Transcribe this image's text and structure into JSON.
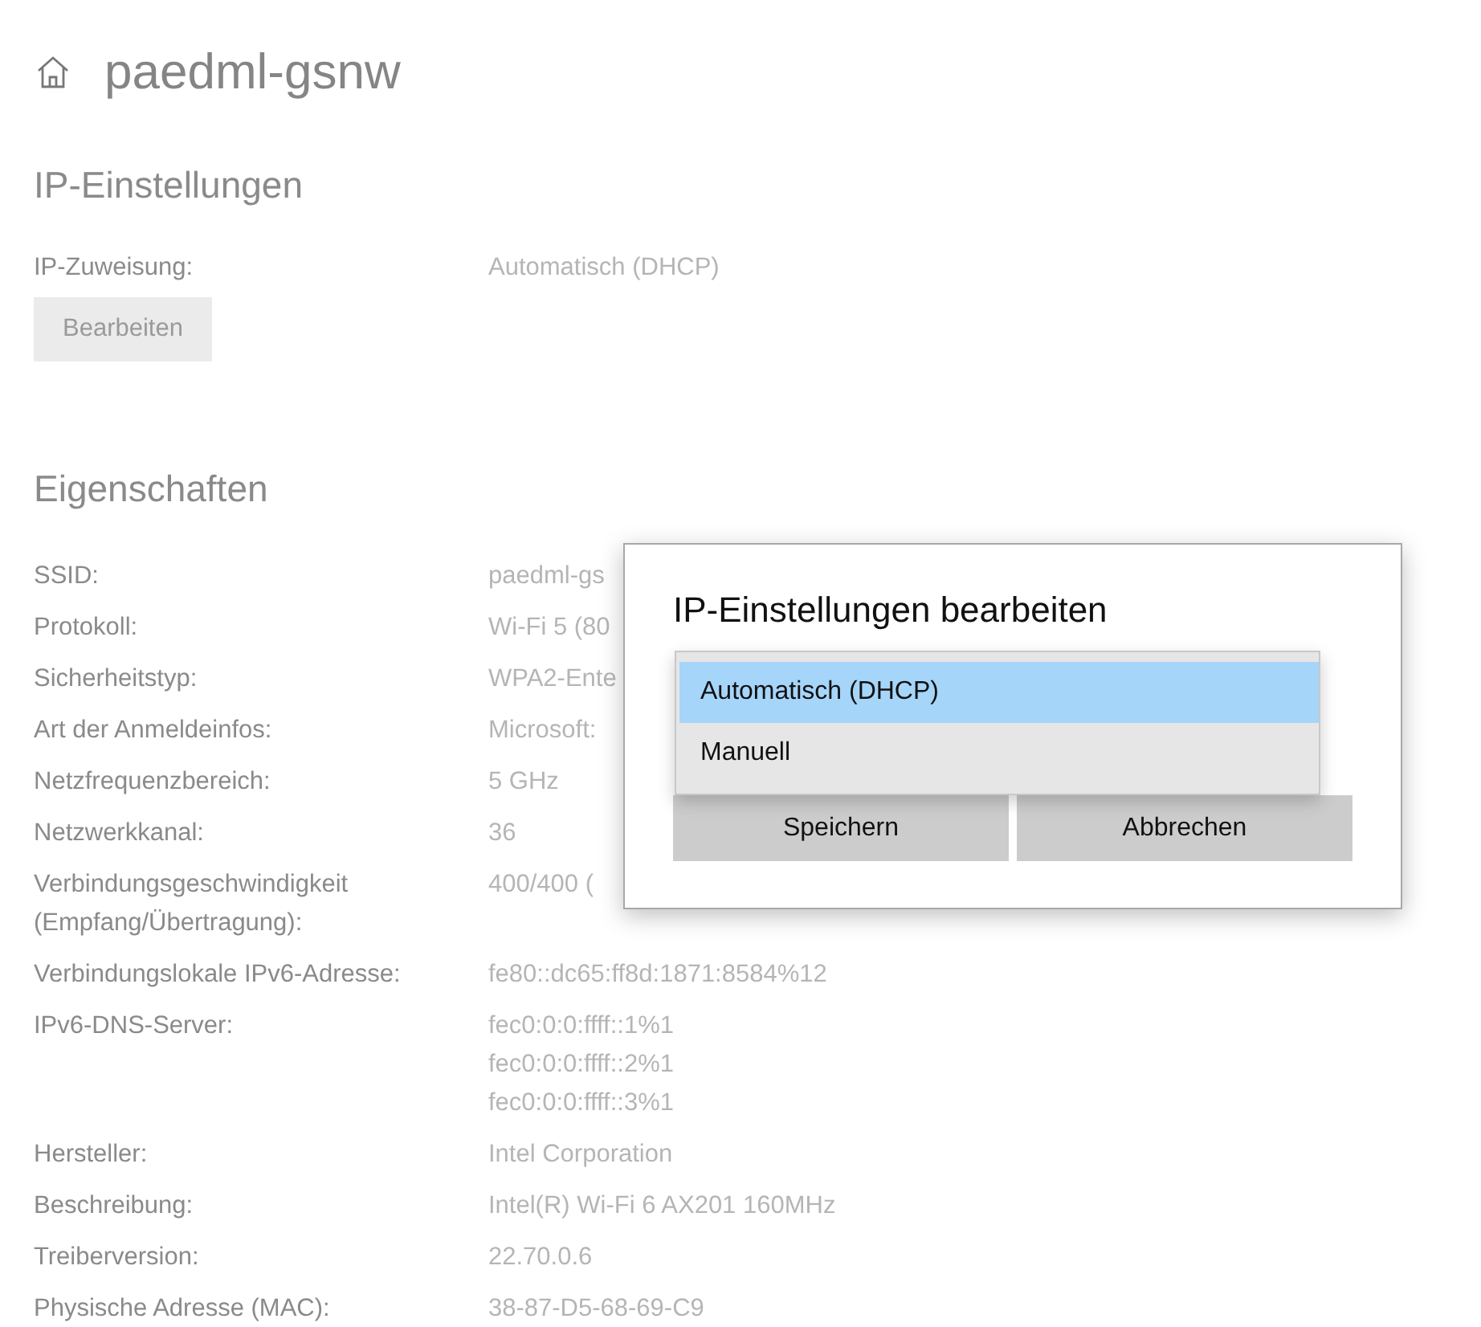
{
  "header": {
    "title": "paedml-gsnw"
  },
  "ip_settings": {
    "heading": "IP-Einstellungen",
    "rows": [
      {
        "label": "IP-Zuweisung:",
        "values": [
          "Automatisch (DHCP)"
        ]
      }
    ],
    "edit_button": {
      "label": "Bearbeiten",
      "disabled": true
    }
  },
  "properties": {
    "heading": "Eigenschaften",
    "rows": [
      {
        "label": "SSID:",
        "values": [
          "paedml-gs"
        ]
      },
      {
        "label": "Protokoll:",
        "values": [
          "Wi-Fi 5 (80"
        ]
      },
      {
        "label": "Sicherheitstyp:",
        "values": [
          "WPA2-Ente"
        ]
      },
      {
        "label": "Art der Anmeldeinfos:",
        "values": [
          "Microsoft:"
        ]
      },
      {
        "label": "Netzfrequenzbereich:",
        "values": [
          "5 GHz"
        ]
      },
      {
        "label": "Netzwerkkanal:",
        "values": [
          "36"
        ]
      },
      {
        "label": "Verbindungsgeschwindigkeit (Empfang/Übertragung):",
        "values": [
          "400/400 ("
        ]
      },
      {
        "label": "Verbindungslokale IPv6-Adresse:",
        "values": [
          "fe80::dc65:ff8d:1871:8584%12"
        ]
      },
      {
        "label": "IPv6-DNS-Server:",
        "values": [
          "fec0:0:0:ffff::1%1",
          "fec0:0:0:ffff::2%1",
          "fec0:0:0:ffff::3%1"
        ]
      },
      {
        "label": "Hersteller:",
        "values": [
          "Intel Corporation"
        ]
      },
      {
        "label": "Beschreibung:",
        "values": [
          "Intel(R) Wi-Fi 6 AX201 160MHz"
        ]
      },
      {
        "label": "Treiberversion:",
        "values": [
          "22.70.0.6"
        ]
      },
      {
        "label": "Physische Adresse (MAC):",
        "values": [
          "38-87-D5-68-69-C9"
        ]
      }
    ]
  },
  "dialog": {
    "title": "IP-Einstellungen bearbeiten",
    "options": [
      {
        "label": "Automatisch (DHCP)",
        "selected": true
      },
      {
        "label": "Manuell",
        "selected": false
      }
    ],
    "buttons": [
      "Speichern",
      "Abbrechen"
    ]
  }
}
